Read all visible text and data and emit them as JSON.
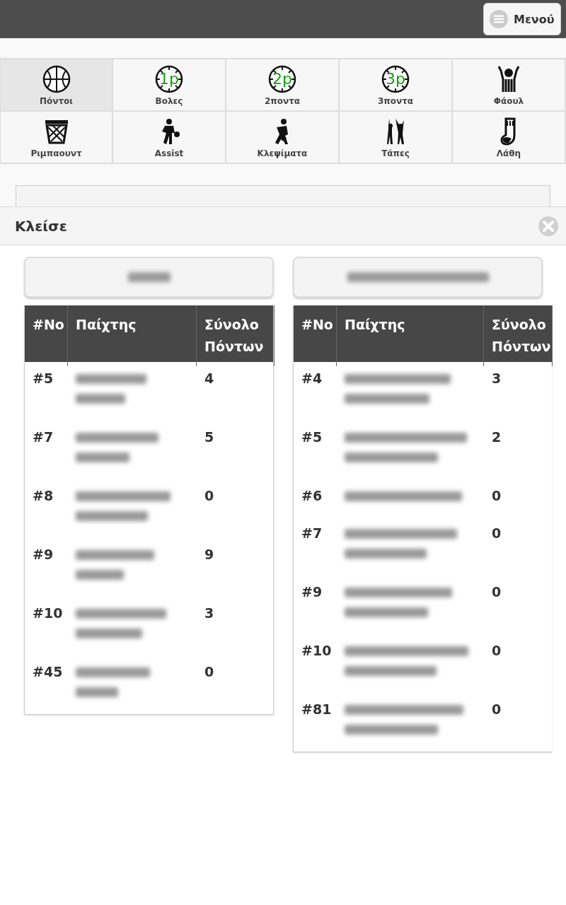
{
  "header": {
    "menu_button": "Μενού"
  },
  "categories": [
    {
      "label": "Πόντοι",
      "kind": "ball",
      "selected": true
    },
    {
      "label": "Βολες",
      "kind": "clock",
      "badge": "1p",
      "selected": false
    },
    {
      "label": "2ποντα",
      "kind": "clock",
      "badge": "2p",
      "selected": false
    },
    {
      "label": "3ποντα",
      "kind": "clock",
      "badge": "3p",
      "selected": false
    },
    {
      "label": "Φάουλ",
      "kind": "foul",
      "selected": false
    },
    {
      "label": "Ριμπαουντ",
      "kind": "hoop",
      "selected": false
    },
    {
      "label": "Assist",
      "kind": "dribble",
      "selected": false
    },
    {
      "label": "Κλεψίματα",
      "kind": "steal",
      "selected": false
    },
    {
      "label": "Τάπες",
      "kind": "block",
      "selected": false
    },
    {
      "label": "Λάθη",
      "kind": "sock",
      "selected": false
    }
  ],
  "panel": {
    "close_label": "Κλείσε",
    "teams": [
      {
        "kind": "short",
        "columns": [
          "#No",
          "Παίχτης",
          "Σύνολο Πόντων"
        ],
        "rows": [
          {
            "number": "#5",
            "kind": "two-line",
            "points": "4"
          },
          {
            "number": "#7",
            "kind": "two-line",
            "points": "5"
          },
          {
            "number": "#8",
            "kind": "two-line",
            "points": "0"
          },
          {
            "number": "#9",
            "kind": "two-line",
            "points": "9"
          },
          {
            "number": "#10",
            "kind": "two-line",
            "points": "3"
          },
          {
            "number": "#45",
            "kind": "two-line",
            "points": "0"
          }
        ]
      },
      {
        "kind": "long",
        "columns": [
          "#No",
          "Παίχτης",
          "Σύνολο Πόντων"
        ],
        "rows": [
          {
            "number": "#4",
            "kind": "two-line",
            "points": "3"
          },
          {
            "number": "#5",
            "kind": "two-line",
            "points": "2"
          },
          {
            "number": "#6",
            "kind": "one-line",
            "points": "0"
          },
          {
            "number": "#7",
            "kind": "two-line",
            "points": "0"
          },
          {
            "number": "#9",
            "kind": "two-line",
            "points": "0"
          },
          {
            "number": "#10",
            "kind": "two-line",
            "points": "0"
          },
          {
            "number": "#81",
            "kind": "two-line",
            "points": "0"
          }
        ]
      }
    ]
  }
}
